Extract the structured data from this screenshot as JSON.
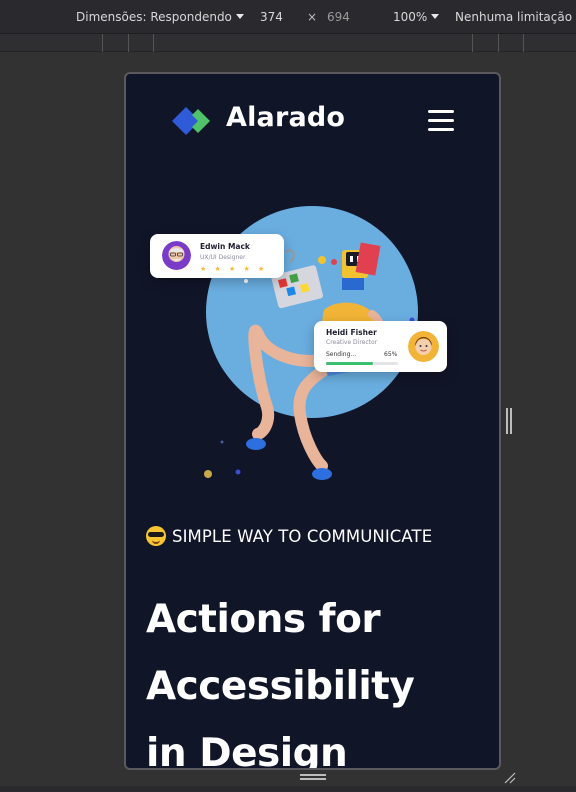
{
  "toolbar": {
    "dimensions_label": "Dimensões: Respondendo",
    "width": "374",
    "separator": "×",
    "height": "694",
    "zoom": "100%",
    "throttling": "Nenhuma limitação"
  },
  "site": {
    "brand": "Alarado",
    "colors": {
      "background": "#111528",
      "logo_blue": "#2f5bd8",
      "logo_green": "#4fc26a",
      "circle": "#6aaee0"
    },
    "cards": [
      {
        "name": "Edwin Mack",
        "role": "UX/UI Designer",
        "rating_stars": "★ ★ ★ ★ ★"
      },
      {
        "name": "Heidi Fisher",
        "role": "Creative Director",
        "status": "Sending...",
        "progress_label": "65%",
        "progress": 0.65
      }
    ],
    "tagline": "SIMPLE WAY TO COMMUNICATE",
    "headline": [
      "Actions for",
      "Accessibility",
      "in Design"
    ]
  },
  "icons": {
    "menu": "hamburger-menu-icon",
    "logo": "diamond-logo-icon",
    "emoji": "sunglasses-emoji-icon"
  }
}
